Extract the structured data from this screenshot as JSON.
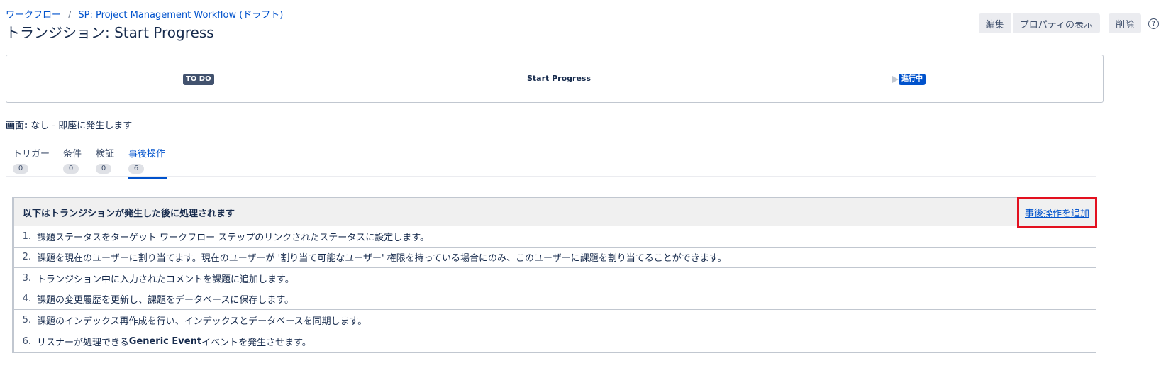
{
  "breadcrumb": {
    "root": "ワークフロー",
    "separator": "/",
    "current": "SP: Project Management Workflow (ドラフト)"
  },
  "title": "トランジション: Start Progress",
  "toolbar": {
    "edit_label": "編集",
    "properties_label": "プロパティの表示",
    "delete_label": "削除",
    "help_icon": "?"
  },
  "diagram": {
    "from_status": "TO DO",
    "transition": "Start Progress",
    "to_status": "進行中"
  },
  "screen": {
    "label": "画面:",
    "value": " なし - 即座に発生します"
  },
  "tabs": [
    {
      "label": "トリガー",
      "count": "0"
    },
    {
      "label": "条件",
      "count": "0"
    },
    {
      "label": "検証",
      "count": "0"
    },
    {
      "label": "事後操作",
      "count": "6",
      "active": true
    }
  ],
  "post_functions": {
    "header": "以下はトランジションが発生した後に処理されます",
    "add_link": "事後操作を追加",
    "items": [
      {
        "num": "1.",
        "text": "課題ステータスをターゲット ワークフロー ステップのリンクされたステータスに設定します。"
      },
      {
        "num": "2.",
        "text": "課題を現在のユーザーに割り当てます。現在のユーザーが '割り当て可能なユーザー' 権限を持っている場合にのみ、このユーザーに課題を割り当てることができます。"
      },
      {
        "num": "3.",
        "text": "トランジション中に入力されたコメントを課題に追加します。"
      },
      {
        "num": "4.",
        "text": "課題の変更履歴を更新し、課題をデータベースに保存します。"
      },
      {
        "num": "5.",
        "text": "課題のインデックス再作成を行い、インデックスとデータベースを同期します。"
      },
      {
        "num": "6.",
        "text_before": "リスナーが処理できる ",
        "text_strong": "Generic Event",
        "text_after": " イベントを発生させます。"
      }
    ]
  },
  "colors": {
    "link": "#0052cc",
    "todo_badge": "#42526e",
    "progress_badge": "#0052cc",
    "highlight_box": "#e3101f"
  }
}
